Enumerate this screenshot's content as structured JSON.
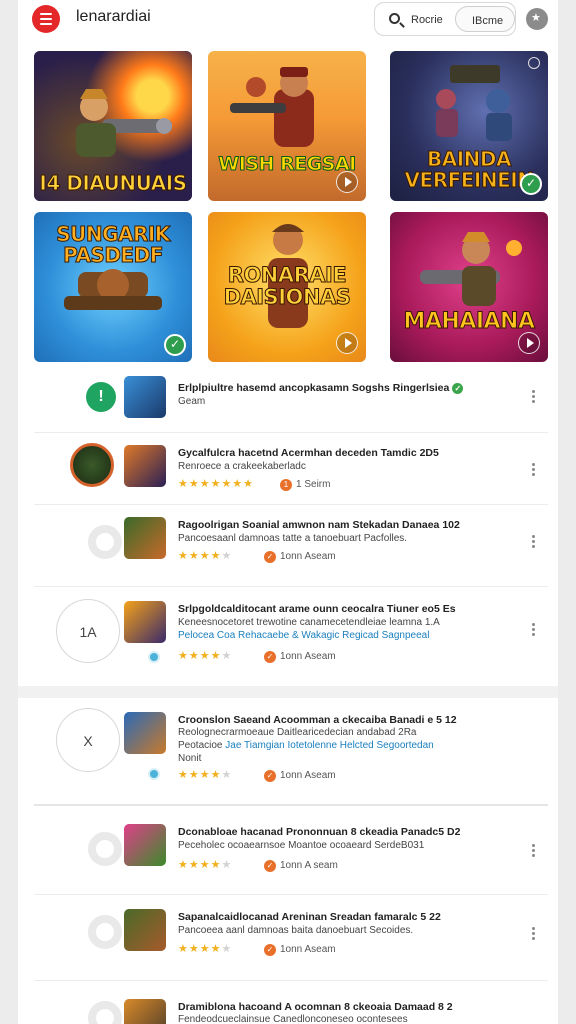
{
  "header": {
    "title": "lenarardiai",
    "search_label": "Rocrie",
    "inner_pill_label": "IBcme",
    "menu_icon": "hamburger-icon",
    "search_icon": "search-icon",
    "avatar_icon": "profile-icon"
  },
  "tiles": [
    {
      "label": "I4 DIAUNUAIS",
      "color": "#ffd23a"
    },
    {
      "label": "WISH REGSAI",
      "color": "#ffd800"
    },
    {
      "label": "BAINDA VERFEINEIN",
      "color": "#f5b21a"
    },
    {
      "label": "SUNGARIK PASDEDF",
      "color": "#ffb020"
    },
    {
      "label": "RONARAIE DAISIONAS",
      "color": "#ffcf3a"
    },
    {
      "label": "MAHAIANA",
      "color": "#ffc41f"
    }
  ],
  "list": [
    {
      "title": "Erlplpiultre hasemd ancopkasamn Sogshs Ringerlsiea",
      "line2": "Geam",
      "verified": true
    },
    {
      "title": "Gycalfulcra hacetnd Acermhan deceden Tamdic 2D5",
      "line2": "Renroece a crakeekaberladc",
      "rating": "4.5",
      "badge_text": "1",
      "meta": "1 Seirm"
    },
    {
      "title": "Ragoolrigan Soanial amwnon nam Stekadan Danaea 102",
      "line2": "Pancoesaanl  damnoas tatte a tanoebuart Pacfolles.",
      "rating": "4.0",
      "meta": "1onn Aseam"
    },
    {
      "title": "Srlpgoldcalditocant arame ounn ceocalra Tiuner eo5 Es",
      "line2": "Keneesnocetoret trewotine canamecetendleiae leamna 1.A",
      "link": "Pelocea Coa Rehacaebe & Wakagic Regicad Sagnpeeal",
      "rating": "4.0",
      "meta": "1onn Aseam",
      "circle_label": "1A"
    },
    {
      "title": "Croonslon Saeand Acoomman a ckecaiba Banadi e 5 12",
      "line2": "Reolognecrarmoeaue Daitlearicedecian andabad 2Ra",
      "line3": "Peotacioe",
      "link": "Jae Tiamgian Iotetolenne Helcted Segoortedan",
      "line4": "Nonit",
      "rating": "4.0",
      "meta": "1onn Aseam",
      "circle_label": "X"
    },
    {
      "title": "Dconabloae hacanad Prononnuan 8 ckeadia Panadc5 D2",
      "line2": "Peceholec ocoaearnsoe Moantoe ocoaeard SerdeB031",
      "rating": "4.0",
      "meta": "1onn A seam"
    },
    {
      "title": "Sapanalcaidlocanad Areninan Sreadan famaralc 5 22",
      "line2": "Pancoeea aanl  damnoas baita  danoebuart Secoides.",
      "rating": "4.0",
      "meta": "1onn Aseam"
    },
    {
      "title": "Dramiblona hacoand A ocomnan 8 ckeoaia Damaad 8 2",
      "line2": "Fendeodcueclainsue Canedlonconeseo ocontesees"
    }
  ]
}
